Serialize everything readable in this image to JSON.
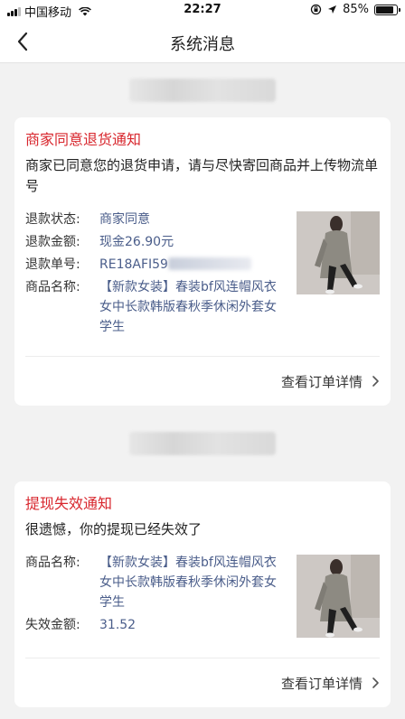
{
  "status_bar": {
    "carrier": "中国移动",
    "time": "22:27",
    "battery": "85%",
    "battery_level": 0.85
  },
  "nav": {
    "title": "系统消息"
  },
  "messages": [
    {
      "title": "商家同意退货通知",
      "description": "商家已同意您的退货申请，请与尽快寄回商品并上传物流单号",
      "fields": [
        {
          "label": "退款状态:",
          "value": "商家同意"
        },
        {
          "label": "退款金额:",
          "value": "现金26.90元"
        },
        {
          "label": "退款单号:",
          "value": "RE18AFI59"
        },
        {
          "label": "商品名称:",
          "value": "【新款女装】春装bf风连帽风衣女中长款韩版春秋季休闲外套女学生"
        }
      ],
      "detail_label": "查看订单详情"
    },
    {
      "title": "提现失效通知",
      "description": "很遗憾，你的提现已经失效了",
      "fields": [
        {
          "label": "商品名称:",
          "value": "【新款女装】春装bf风连帽风衣女中长款韩版春秋季休闲外套女学生"
        },
        {
          "label": "失效金额:",
          "value": "31.52"
        }
      ],
      "detail_label": "查看订单详情"
    }
  ],
  "colors": {
    "title_red": "#d8262d",
    "value_blue": "#4a5d8a",
    "background": "#f2f2f2"
  }
}
